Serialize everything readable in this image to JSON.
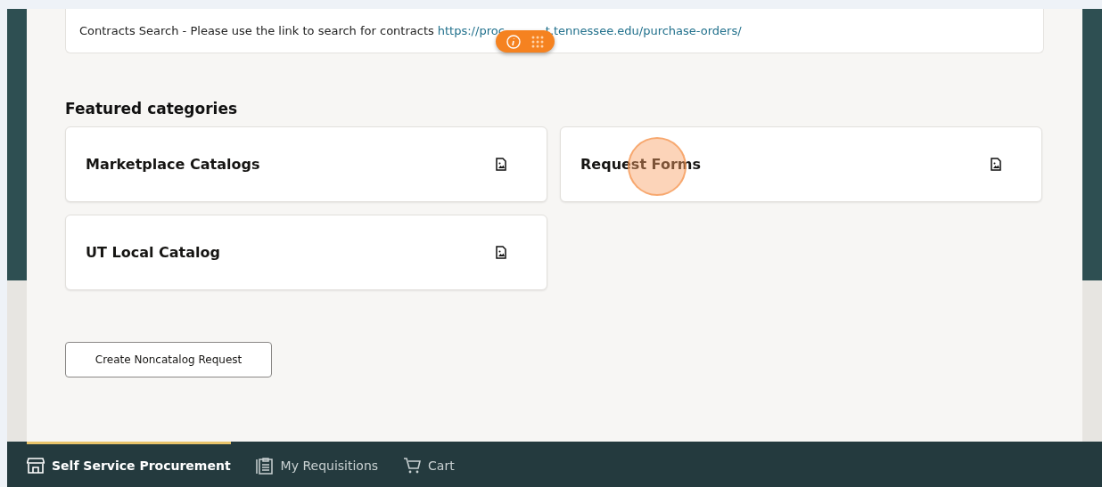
{
  "notice": {
    "text": "Contracts Search - Please use the link to search for contracts",
    "link_start": "https://proc",
    "link_end": "t.tennessee.edu/purchase-orders/"
  },
  "featured": {
    "heading": "Featured categories",
    "items": [
      {
        "label": "Marketplace Catalogs",
        "highlighted": false
      },
      {
        "label": "Request Forms",
        "highlighted": true
      },
      {
        "label": "UT Local Catalog",
        "highlighted": false
      }
    ]
  },
  "create_button": "Create Noncatalog Request",
  "nav": [
    {
      "label": "Self Service Procurement",
      "kind": "store",
      "selected": true
    },
    {
      "label": "My Requisitions",
      "kind": "clipboard",
      "selected": false
    },
    {
      "label": "Cart",
      "kind": "cart",
      "selected": false
    }
  ]
}
